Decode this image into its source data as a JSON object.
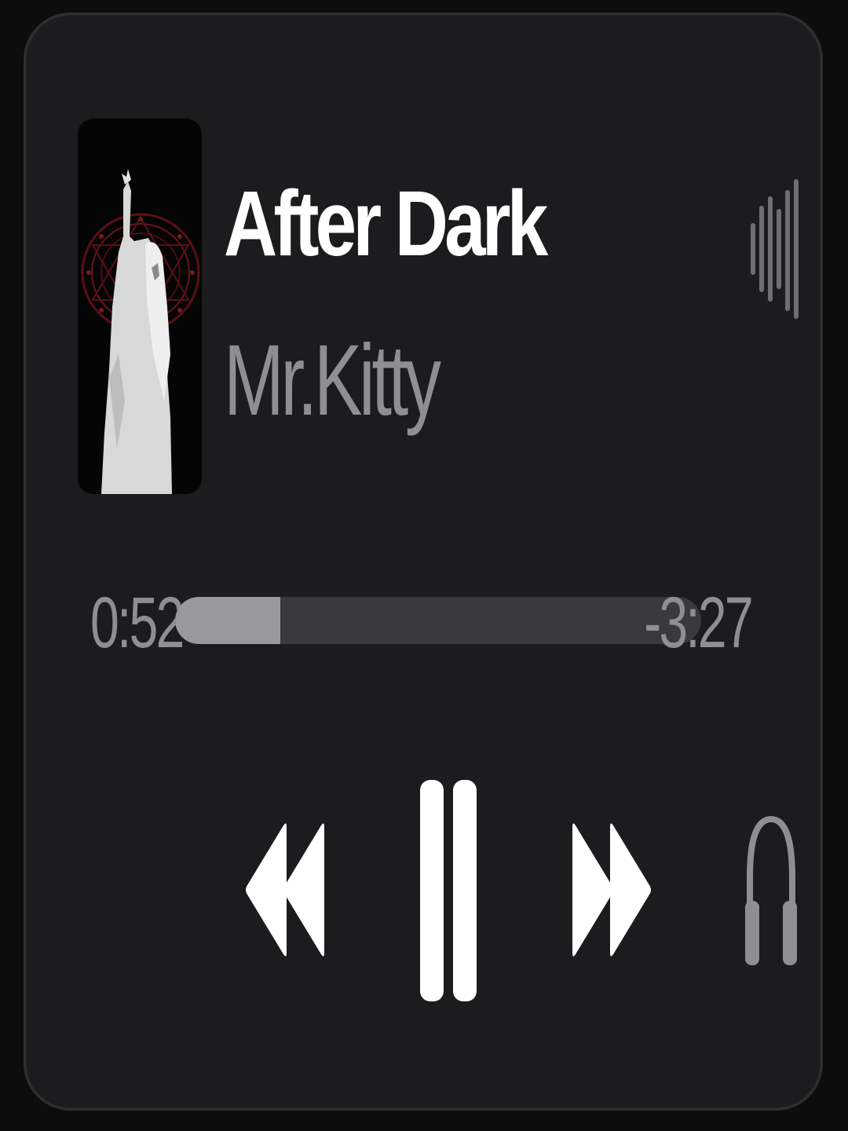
{
  "now_playing": {
    "title": "After Dark",
    "artist": "Mr.Kitty",
    "artwork_icon": "album-artwork-image"
  },
  "progress": {
    "elapsed": "0:52",
    "remaining": "-3:27",
    "fraction": 0.2
  },
  "controls": {
    "rewind_icon": "rewind-icon",
    "pause_icon": "pause-icon",
    "forward_icon": "fast-forward-icon",
    "output_icon": "headphones-icon",
    "waveform_icon": "audio-waveform-icon"
  },
  "colors": {
    "background": "#1c1c1e",
    "title": "#ffffff",
    "secondary": "#8e8e93",
    "track": "#3a3a3c",
    "fill": "#98989d"
  }
}
